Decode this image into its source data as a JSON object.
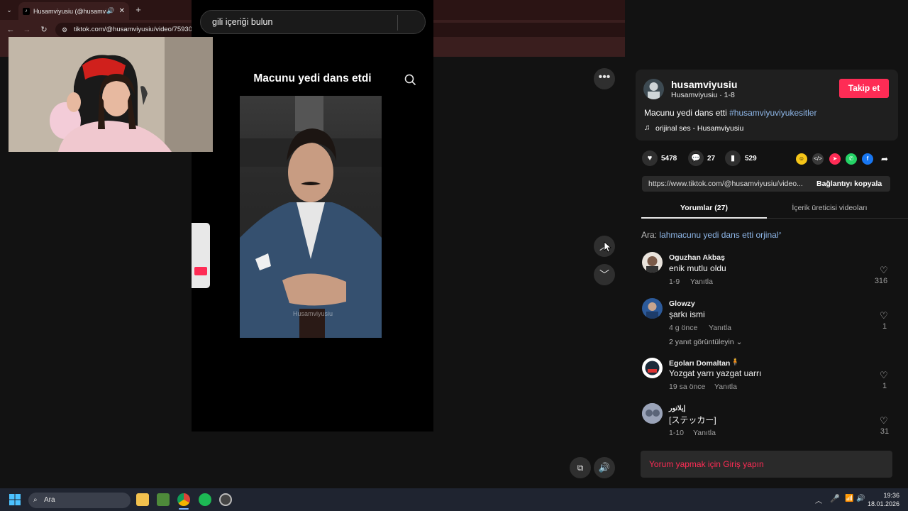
{
  "browser": {
    "tab_title": "Husamviyusiu (@husamviyu",
    "url": "tiktok.com/@husamviyusiu/video/7593081087954341141"
  },
  "page": {
    "search_placeholder": "gili içeriği bulun",
    "overlay_title": "Macunu yedi dans etdi",
    "watermark": "Husamviyusiu"
  },
  "author": {
    "username": "husamviyusiu",
    "nickname_date": "Husamviyusiu · 1-8",
    "follow_label": "Takip et",
    "caption_text": "Macunu yedi dans etti",
    "caption_hashtag": "#husamviyuviyukesitler",
    "sound": "orijinal ses - Husamviyusiu"
  },
  "stats": {
    "likes": "5478",
    "comments": "27",
    "saves": "529"
  },
  "copy_link": {
    "url": "https://www.tiktok.com/@husamviyusiu/video...",
    "button": "Bağlantıyı kopyala"
  },
  "tabs": {
    "comments": "Yorumlar (27)",
    "creator_videos": "İçerik üreticisi videoları"
  },
  "related_search": {
    "prefix": "Ara:",
    "query": "lahmacunu yedi dans etti orjinal"
  },
  "comments": [
    {
      "name": "Oguzhan Akbaş",
      "text": "enik mutlu oldu",
      "date": "1-9",
      "reply": "Yanıtla",
      "likes": "316",
      "more": ""
    },
    {
      "name": "Glowzy",
      "text": "şarkı ismi",
      "date": "4 g önce",
      "reply": "Yanıtla",
      "likes": "1",
      "more": "2 yanıt görüntüleyin"
    },
    {
      "name": "Egoları Domaltan",
      "text": "Yozgat yarrı yazgat uarrı",
      "date": "19 sa önce",
      "reply": "Yanıtla",
      "likes": "1",
      "more": ""
    },
    {
      "name": "إيلاتور",
      "text": "[ステッカー]",
      "date": "1-10",
      "reply": "Yanıtla",
      "likes": "31",
      "more": ""
    }
  ],
  "login_prompt": "Yorum yapmak için Giriş yapın",
  "taskbar": {
    "search": "Ara",
    "time": "19:36",
    "date": "18.01.2026"
  },
  "colors": {
    "accent": "#fe2c55",
    "hashtag": "#8fb8ea"
  }
}
